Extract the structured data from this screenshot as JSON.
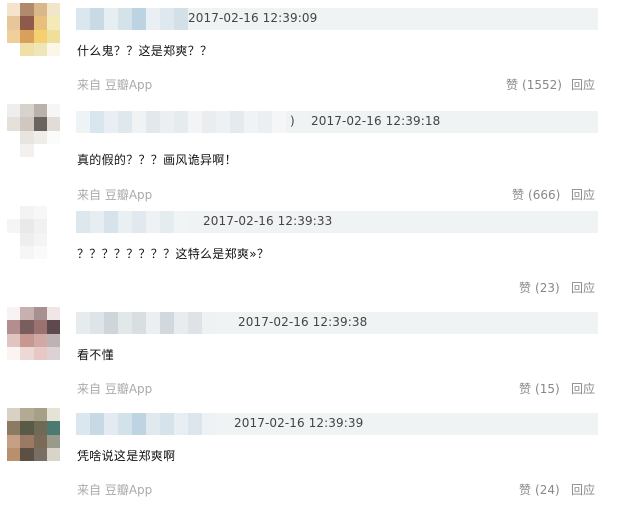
{
  "comments": [
    {
      "timestamp": "2017-02-16 12:39:09",
      "text": "什么鬼？？这是郑爽？？",
      "source": "来自 豆瓣App",
      "like_label": "赞",
      "like_count": "(1552)",
      "reply_label": "回应"
    },
    {
      "timestamp": "2017-02-16 12:39:18",
      "name_suffix": ")",
      "text": "真的假的？？？画风诡异啊！",
      "source": "来自 豆瓣App",
      "like_label": "赞",
      "like_count": "(666)",
      "reply_label": "回应"
    },
    {
      "timestamp": "2017-02-16 12:39:33",
      "text": "？？？？？？？？这特么是郑爽»？",
      "source": "",
      "like_label": "赞",
      "like_count": "(23)",
      "reply_label": "回应"
    },
    {
      "timestamp": "2017-02-16 12:39:38",
      "text": "看不懂",
      "source": "来自 豆瓣App",
      "like_label": "赞",
      "like_count": "(15)",
      "reply_label": "回应"
    },
    {
      "timestamp": "2017-02-16 12:39:39",
      "text": "凭啥说这是郑爽啊",
      "source": "来自 豆瓣App",
      "like_label": "赞",
      "like_count": "(24)",
      "reply_label": "回应"
    }
  ]
}
